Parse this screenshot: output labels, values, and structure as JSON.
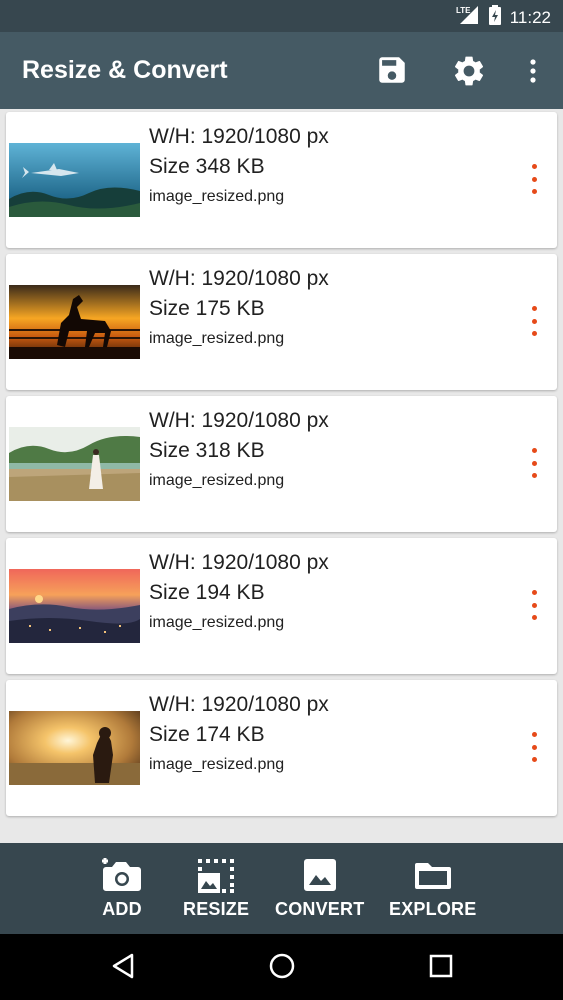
{
  "status_bar": {
    "network": "LTE",
    "time": "11:22"
  },
  "app_bar": {
    "title": "Resize & Convert"
  },
  "icons": {
    "save": "save-icon",
    "settings": "gear-icon",
    "overflow": "more-vert-icon",
    "item_menu": "more-vert-icon"
  },
  "items": [
    {
      "dims": "W/H: 1920/1080 px",
      "size": "Size 348 KB",
      "filename": "image_resized.png",
      "thumb": "shark underwater"
    },
    {
      "dims": "W/H: 1920/1080 px",
      "size": "Size 175 KB",
      "filename": "image_resized.png",
      "thumb": "horse at sunset"
    },
    {
      "dims": "W/H: 1920/1080 px",
      "size": "Size 318 KB",
      "filename": "image_resized.png",
      "thumb": "woman in field"
    },
    {
      "dims": "W/H: 1920/1080 px",
      "size": "Size 194 KB",
      "filename": "image_resized.png",
      "thumb": "city at dusk"
    },
    {
      "dims": "W/H: 1920/1080 px",
      "size": "Size 174 KB",
      "filename": "image_resized.png",
      "thumb": "silhouette at sunset"
    }
  ],
  "bottom_bar": {
    "add": "ADD",
    "resize": "RESIZE",
    "convert": "CONVERT",
    "explore": "EXPLORE"
  },
  "colors": {
    "app_bar": "#455a64",
    "status_bar": "#37474f",
    "accent": "#e64a19"
  }
}
